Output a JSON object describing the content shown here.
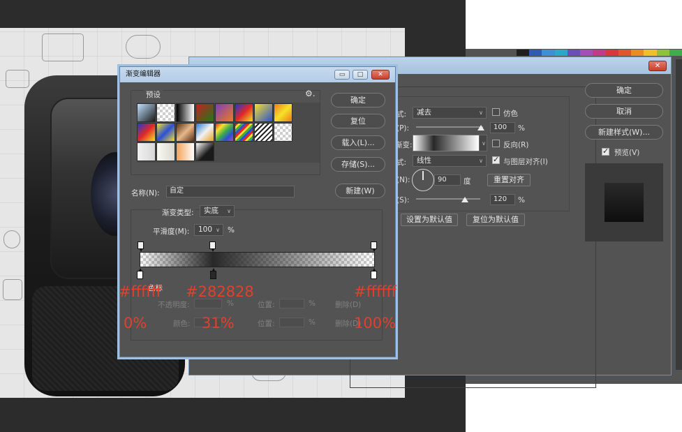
{
  "gradient_editor": {
    "title": "渐变编辑器",
    "presets_label": "预设",
    "buttons": {
      "ok": "确定",
      "reset": "复位",
      "load": "载入(L)...",
      "save": "存储(S)...",
      "new": "新建(W)"
    },
    "name_label": "名称(N):",
    "name_value": "自定",
    "gradient_type_label": "渐变类型:",
    "gradient_type_value": "实底",
    "smoothness_label": "平滑度(M):",
    "smoothness_value": "100",
    "smoothness_unit": "%",
    "stops_section_label": "色标",
    "opacity_label": "不透明度:",
    "opacity_unit": "%",
    "location_label": "位置:",
    "location_unit": "%",
    "delete_label": "删除(D)",
    "color_label": "颜色:",
    "location_label_2": "位置:",
    "location_unit_2": "%",
    "delete_label_2": "删除(D)"
  },
  "layer_style": {
    "blend_mode_label": "式:",
    "blend_mode_value": "减去",
    "dither_label": "仿色",
    "opacity_label": "(P):",
    "opacity_value": "100",
    "opacity_unit": "%",
    "gradient_label": "渐变:",
    "reverse_label": "反向(R)",
    "style_label": "式:",
    "style_value": "线性",
    "align_label": "与图层对齐(I)",
    "angle_label": "(N):",
    "angle_value": "90",
    "angle_unit": "度",
    "reset_align_button": "重置对齐",
    "scale_label": "(S):",
    "scale_value": "120",
    "scale_unit": "%",
    "set_default_button": "设置为默认值",
    "reset_default_button": "复位为默认值",
    "ok_button": "确定",
    "cancel_button": "取消",
    "new_style_button": "新建样式(W)...",
    "preview_label": "预览(V)",
    "preview_checked": true,
    "dither_checked": false,
    "reverse_checked": false,
    "align_checked": true
  },
  "annotations": {
    "left_color": "#ffffff",
    "mid_color": "#282828",
    "right_color": "#ffffff",
    "left_pos": "0%",
    "mid_pos": "31%",
    "right_pos": "100%"
  },
  "colors": {
    "dialog_bg": "#535353",
    "annotation_red": "#e2402d",
    "gradient_start": "#ffffff",
    "gradient_mid": "#282828",
    "gradient_end": "#ffffff"
  },
  "gradient_stops": [
    {
      "color": "#ffffff",
      "location_percent": 0
    },
    {
      "color": "#282828",
      "location_percent": 31
    },
    {
      "color": "#ffffff",
      "location_percent": 100
    }
  ],
  "icons": {
    "settings": "gear-icon",
    "minimize": "minimize-icon",
    "maximize": "maximize-icon",
    "close": "close-icon"
  }
}
